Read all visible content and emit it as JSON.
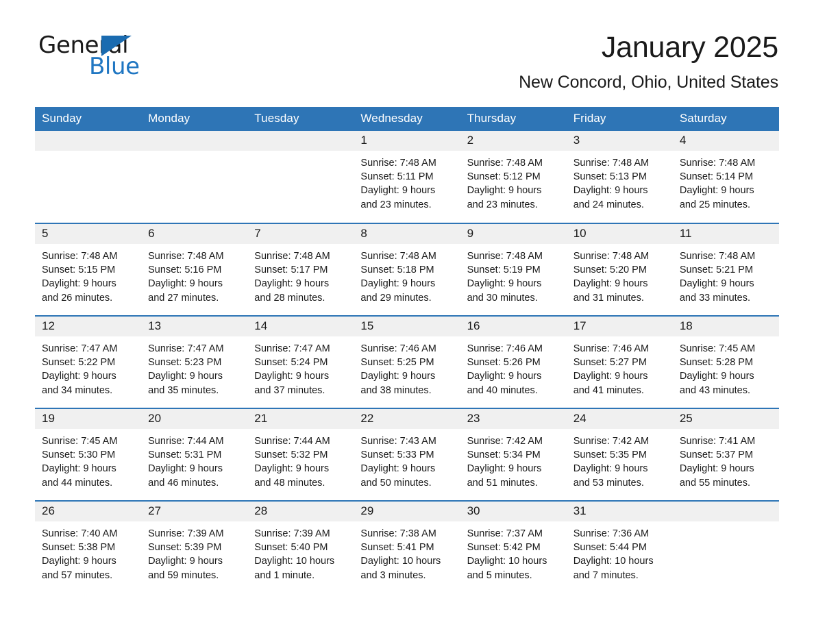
{
  "brand": {
    "logo_word_1": "General",
    "logo_word_2": "Blue",
    "triangle_icon": "triangle-icon",
    "accent_color": "#2E75B6",
    "logo_blue": "#1f76c2"
  },
  "header": {
    "title": "January 2025",
    "subtitle": "New Concord, Ohio, United States"
  },
  "calendar": {
    "weekday_headers": [
      "Sunday",
      "Monday",
      "Tuesday",
      "Wednesday",
      "Thursday",
      "Friday",
      "Saturday"
    ],
    "weeks": [
      [
        {
          "day": "",
          "lines": []
        },
        {
          "day": "",
          "lines": []
        },
        {
          "day": "",
          "lines": []
        },
        {
          "day": "1",
          "lines": [
            "Sunrise: 7:48 AM",
            "Sunset: 5:11 PM",
            "Daylight: 9 hours",
            "and 23 minutes."
          ]
        },
        {
          "day": "2",
          "lines": [
            "Sunrise: 7:48 AM",
            "Sunset: 5:12 PM",
            "Daylight: 9 hours",
            "and 23 minutes."
          ]
        },
        {
          "day": "3",
          "lines": [
            "Sunrise: 7:48 AM",
            "Sunset: 5:13 PM",
            "Daylight: 9 hours",
            "and 24 minutes."
          ]
        },
        {
          "day": "4",
          "lines": [
            "Sunrise: 7:48 AM",
            "Sunset: 5:14 PM",
            "Daylight: 9 hours",
            "and 25 minutes."
          ]
        }
      ],
      [
        {
          "day": "5",
          "lines": [
            "Sunrise: 7:48 AM",
            "Sunset: 5:15 PM",
            "Daylight: 9 hours",
            "and 26 minutes."
          ]
        },
        {
          "day": "6",
          "lines": [
            "Sunrise: 7:48 AM",
            "Sunset: 5:16 PM",
            "Daylight: 9 hours",
            "and 27 minutes."
          ]
        },
        {
          "day": "7",
          "lines": [
            "Sunrise: 7:48 AM",
            "Sunset: 5:17 PM",
            "Daylight: 9 hours",
            "and 28 minutes."
          ]
        },
        {
          "day": "8",
          "lines": [
            "Sunrise: 7:48 AM",
            "Sunset: 5:18 PM",
            "Daylight: 9 hours",
            "and 29 minutes."
          ]
        },
        {
          "day": "9",
          "lines": [
            "Sunrise: 7:48 AM",
            "Sunset: 5:19 PM",
            "Daylight: 9 hours",
            "and 30 minutes."
          ]
        },
        {
          "day": "10",
          "lines": [
            "Sunrise: 7:48 AM",
            "Sunset: 5:20 PM",
            "Daylight: 9 hours",
            "and 31 minutes."
          ]
        },
        {
          "day": "11",
          "lines": [
            "Sunrise: 7:48 AM",
            "Sunset: 5:21 PM",
            "Daylight: 9 hours",
            "and 33 minutes."
          ]
        }
      ],
      [
        {
          "day": "12",
          "lines": [
            "Sunrise: 7:47 AM",
            "Sunset: 5:22 PM",
            "Daylight: 9 hours",
            "and 34 minutes."
          ]
        },
        {
          "day": "13",
          "lines": [
            "Sunrise: 7:47 AM",
            "Sunset: 5:23 PM",
            "Daylight: 9 hours",
            "and 35 minutes."
          ]
        },
        {
          "day": "14",
          "lines": [
            "Sunrise: 7:47 AM",
            "Sunset: 5:24 PM",
            "Daylight: 9 hours",
            "and 37 minutes."
          ]
        },
        {
          "day": "15",
          "lines": [
            "Sunrise: 7:46 AM",
            "Sunset: 5:25 PM",
            "Daylight: 9 hours",
            "and 38 minutes."
          ]
        },
        {
          "day": "16",
          "lines": [
            "Sunrise: 7:46 AM",
            "Sunset: 5:26 PM",
            "Daylight: 9 hours",
            "and 40 minutes."
          ]
        },
        {
          "day": "17",
          "lines": [
            "Sunrise: 7:46 AM",
            "Sunset: 5:27 PM",
            "Daylight: 9 hours",
            "and 41 minutes."
          ]
        },
        {
          "day": "18",
          "lines": [
            "Sunrise: 7:45 AM",
            "Sunset: 5:28 PM",
            "Daylight: 9 hours",
            "and 43 minutes."
          ]
        }
      ],
      [
        {
          "day": "19",
          "lines": [
            "Sunrise: 7:45 AM",
            "Sunset: 5:30 PM",
            "Daylight: 9 hours",
            "and 44 minutes."
          ]
        },
        {
          "day": "20",
          "lines": [
            "Sunrise: 7:44 AM",
            "Sunset: 5:31 PM",
            "Daylight: 9 hours",
            "and 46 minutes."
          ]
        },
        {
          "day": "21",
          "lines": [
            "Sunrise: 7:44 AM",
            "Sunset: 5:32 PM",
            "Daylight: 9 hours",
            "and 48 minutes."
          ]
        },
        {
          "day": "22",
          "lines": [
            "Sunrise: 7:43 AM",
            "Sunset: 5:33 PM",
            "Daylight: 9 hours",
            "and 50 minutes."
          ]
        },
        {
          "day": "23",
          "lines": [
            "Sunrise: 7:42 AM",
            "Sunset: 5:34 PM",
            "Daylight: 9 hours",
            "and 51 minutes."
          ]
        },
        {
          "day": "24",
          "lines": [
            "Sunrise: 7:42 AM",
            "Sunset: 5:35 PM",
            "Daylight: 9 hours",
            "and 53 minutes."
          ]
        },
        {
          "day": "25",
          "lines": [
            "Sunrise: 7:41 AM",
            "Sunset: 5:37 PM",
            "Daylight: 9 hours",
            "and 55 minutes."
          ]
        }
      ],
      [
        {
          "day": "26",
          "lines": [
            "Sunrise: 7:40 AM",
            "Sunset: 5:38 PM",
            "Daylight: 9 hours",
            "and 57 minutes."
          ]
        },
        {
          "day": "27",
          "lines": [
            "Sunrise: 7:39 AM",
            "Sunset: 5:39 PM",
            "Daylight: 9 hours",
            "and 59 minutes."
          ]
        },
        {
          "day": "28",
          "lines": [
            "Sunrise: 7:39 AM",
            "Sunset: 5:40 PM",
            "Daylight: 10 hours",
            "and 1 minute."
          ]
        },
        {
          "day": "29",
          "lines": [
            "Sunrise: 7:38 AM",
            "Sunset: 5:41 PM",
            "Daylight: 10 hours",
            "and 3 minutes."
          ]
        },
        {
          "day": "30",
          "lines": [
            "Sunrise: 7:37 AM",
            "Sunset: 5:42 PM",
            "Daylight: 10 hours",
            "and 5 minutes."
          ]
        },
        {
          "day": "31",
          "lines": [
            "Sunrise: 7:36 AM",
            "Sunset: 5:44 PM",
            "Daylight: 10 hours",
            "and 7 minutes."
          ]
        },
        {
          "day": "",
          "lines": []
        }
      ]
    ]
  }
}
